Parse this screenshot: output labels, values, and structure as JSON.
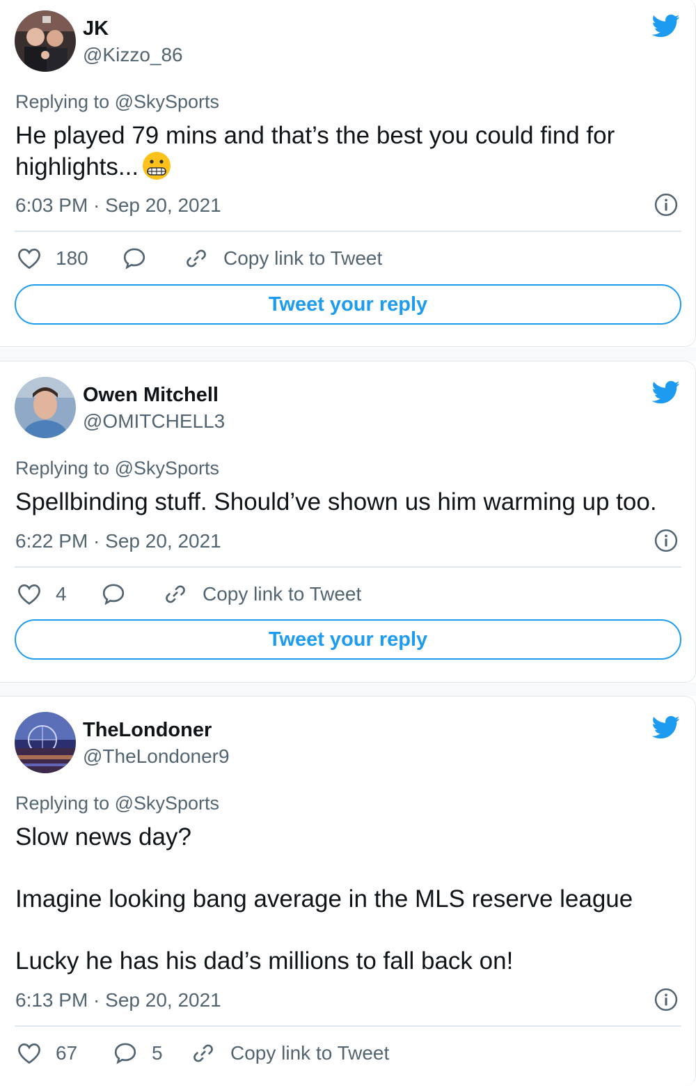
{
  "tweets": [
    {
      "name": "JK",
      "handle": "@Kizzo_86",
      "replying": "Replying to @SkySports",
      "text": "He played 79 mins and that’s the best you could find for highlights...",
      "emoji": "grimacing-face",
      "time": "6:03 PM · Sep 20, 2021",
      "likes": "180",
      "replies": "",
      "copy_link": "Copy link to Tweet",
      "reply_button": "Tweet your reply"
    },
    {
      "name": "Owen Mitchell",
      "handle": "@OMITCHELL3",
      "replying": "Replying to @SkySports",
      "text": "Spellbinding stuff. Should’ve shown us him warming up too.",
      "time": "6:22 PM · Sep 20, 2021",
      "likes": "4",
      "replies": "",
      "copy_link": "Copy link to Tweet",
      "reply_button": "Tweet your reply"
    },
    {
      "name": "TheLondoner",
      "handle": "@TheLondoner9",
      "replying": "Replying to @SkySports",
      "text_lines": [
        "Slow news day?",
        "Imagine looking bang average in the MLS reserve league",
        "Lucky he has his dad’s millions to fall back on!"
      ],
      "time": "6:13 PM · Sep 20, 2021",
      "likes": "67",
      "replies": "5",
      "copy_link": "Copy link to Tweet"
    }
  ],
  "colors": {
    "twitter_blue": "#1d9bf0",
    "secondary_text": "#536471",
    "primary_text": "#0f1419",
    "border": "#e1e8ed"
  },
  "icons": [
    "twitter-bird-icon",
    "info-icon",
    "heart-icon",
    "reply-bubble-icon",
    "link-icon"
  ]
}
